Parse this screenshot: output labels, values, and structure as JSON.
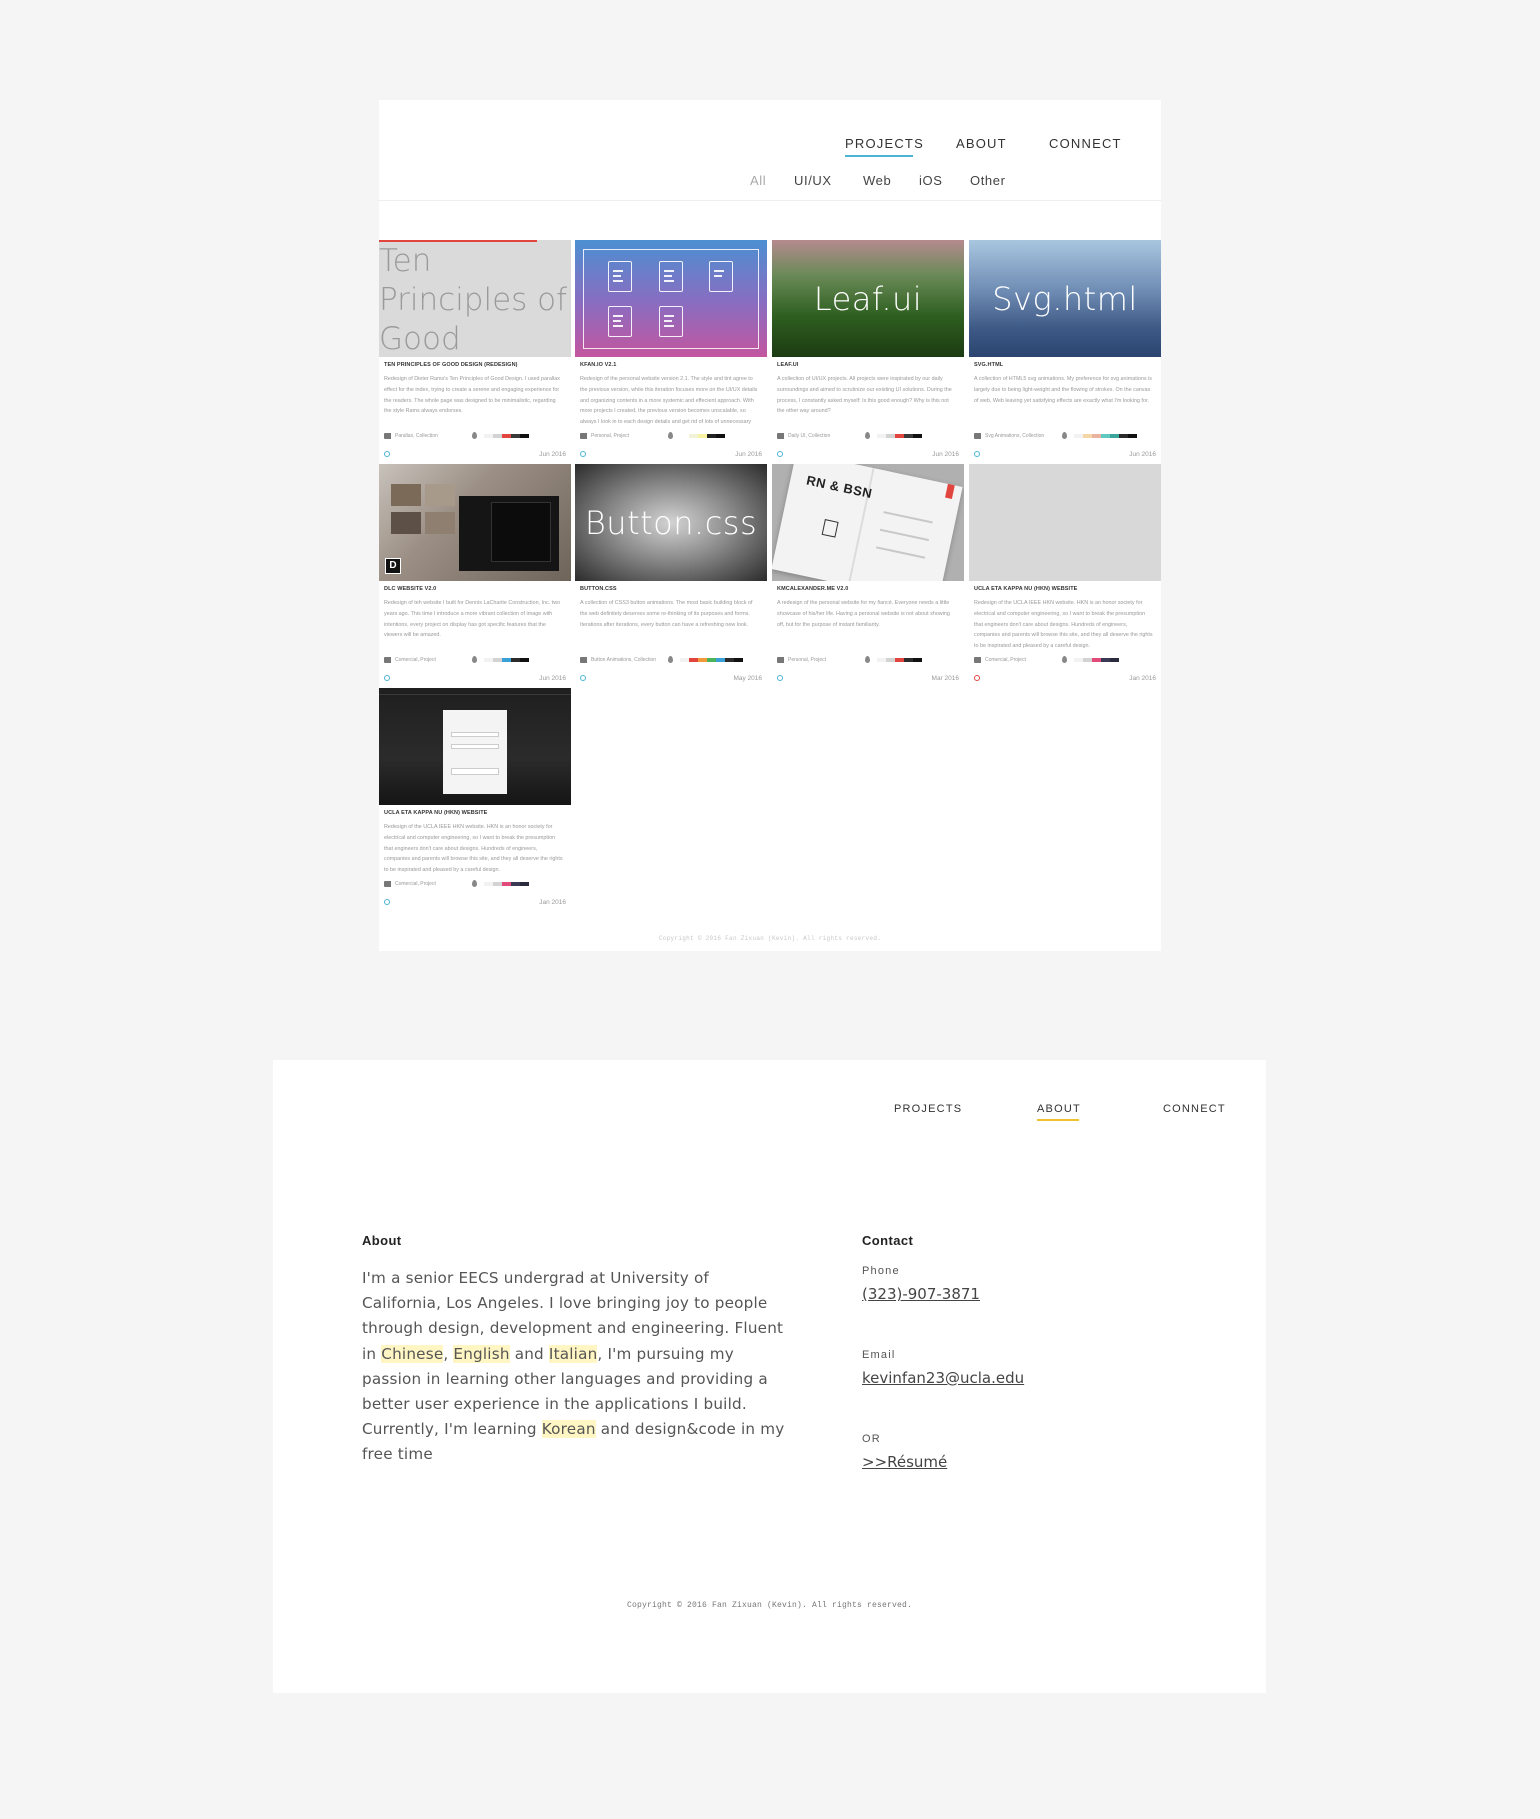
{
  "top": {
    "nav": {
      "projects": "PROJECTS",
      "about": "ABOUT",
      "connect": "CONNECT"
    },
    "filters": [
      "All",
      "UI/UX",
      "Web",
      "iOS",
      "Other"
    ],
    "projects": [
      {
        "thumb_title": "Ten Principles of Good Design",
        "name": "TEN PRINCIPLES OF GOOD DESIGN (REDESIGN)",
        "desc": "Redesign of Dieter Rams's Ten Principles of Good Design. I used parallax effect for the index, trying to create a serene and engaging experience for the readers. The whole page was designed to be minimalistic, regarding the style Rams always endorses.",
        "tags": "Parallax, Collection",
        "palette": [
          "#f2f2f2",
          "#d3d3d3",
          "#e2453e",
          "#3a3a3a",
          "#111111"
        ],
        "date": "Jun 2016",
        "status": "blue"
      },
      {
        "thumb_title": "",
        "name": "KFAN.IO V2.1",
        "desc": "Redesign of the personal website version 2.1. The style and tint agree to the previous version, while this iteration focuses more on the UI/UX details and organizing contents in a more systemic and effecient approach. With more projects I created, the previous version becomes unscalable, so always I look in to each design details and get rid of lots of unnecessary nuances.",
        "tags": "Personal, Project",
        "palette": [
          "#ffffff",
          "#f2f2d8",
          "#f7f3a0",
          "#222222",
          "#111111"
        ],
        "date": "Jun 2016",
        "status": "blue"
      },
      {
        "thumb_title": "Leaf.ui",
        "name": "LEAF.UI",
        "desc": "A collection of UI/UX projects. All projects were inspirated by our daily surroundings and aimed to scrutinize our existing UI solutions. During the process, I constantly asked myself: Is this good enough? Why is this not the other way around?",
        "tags": "Daily UI, Collection",
        "palette": [
          "#f2f2f2",
          "#d3d3d3",
          "#e2453e",
          "#3a3a3a",
          "#111111"
        ],
        "date": "Jun 2016",
        "status": "blue"
      },
      {
        "thumb_title": "Svg.html",
        "name": "SVG.HTML",
        "desc": "A collection of HTML5 svg animations. My preference for svg animations is largely due to being light-weight and the flowing of strokes. On the canvas of web, Web leaving yet satisfying effects are exactly what I'm looking for.",
        "tags": "Svg Animations, Collection",
        "palette": [
          "#f2f2f2",
          "#f4d7a7",
          "#e9b3a0",
          "#5ec9c0",
          "#3aa59b",
          "#2b2b2b",
          "#111111"
        ],
        "date": "Jun 2016",
        "status": "blue"
      },
      {
        "thumb_title": "",
        "name": "DLC WEBSITE V2.0",
        "desc": "Redesign of teh website I built for Dennis LaCharite Construction, Inc. two years ago. This time I introduce a more vibrant collection of image with intentions, every project on display has got specific features that the viewers will be amazed.",
        "tags": "Comercial, Project",
        "palette": [
          "#f2f2f2",
          "#d3d3d3",
          "#3aa1d8",
          "#2b2b2b",
          "#111111"
        ],
        "date": "Jun 2016",
        "status": "blue"
      },
      {
        "thumb_title": "Button.css",
        "name": "BUTTON.CSS",
        "desc": "A collection of CSS3 button animations. The most basic building block of the web definitely deserves some re-thinking of its purposes and forms. Iterations after iterations, every button can have a refreshing new look.",
        "tags": "Button Animations, Collection",
        "palette": [
          "#f2f2f2",
          "#e2453e",
          "#f29a3a",
          "#4bb35a",
          "#3aa1d8",
          "#2b2b2b",
          "#111111"
        ],
        "date": "May 2016",
        "status": "blue"
      },
      {
        "thumb_title": "",
        "name": "KMCALEXANDER.ME V2.0",
        "desc": "A redesign of the personal website for my fiancé. Everyone needs a little showcase of his/her life. Having a personal website is not about showing off, but for the purpose of instant familiarity.",
        "tags": "Personal, Project",
        "palette": [
          "#f2f2f2",
          "#d3d3d3",
          "#e2453e",
          "#2b2b2b",
          "#111111"
        ],
        "date": "Mar 2016",
        "status": "blue"
      },
      {
        "thumb_title": "",
        "name": "UCLA ETA KAPPA NU (HKN) WEBSITE",
        "desc": "Redesign of the UCLA IEEE HKN website. HKN is an honor society for electrical and computer engineering, so I want to break the presumption that engineers don't care about designs. Hundreds of engineers, companies and parents will browse this site, and they all deserve the rights to be inspirated and pleased by a careful design.",
        "tags": "Comercial, Project",
        "palette": [
          "#f2f2f2",
          "#d3d3d3",
          "#e24a7a",
          "#3a3a55",
          "#2b2b3e"
        ],
        "date": "Jan 2016",
        "status": "red"
      },
      {
        "thumb_title": "",
        "name": "UCLA ETA KAPPA NU (HKN) WEBSITE",
        "desc": "Redesign of the UCLA IEEE HKN website. HKN is an honor society for electrical and computer engineering, so I want to break the presumption that engineers don't care about designs. Hundreds of engineers, companies and parents will browse this site, and they all deserve the rights to be inspirated and pleased by a careful design.",
        "tags": "Comercial, Project",
        "palette": [
          "#f2f2f2",
          "#d3d3d3",
          "#e24a7a",
          "#3a3a55",
          "#2b2b3e"
        ],
        "date": "Jan 2016",
        "status": "blue"
      }
    ],
    "copyright": "Copyright © 2016 Fan Zixuan (Kevin). All rights reserved."
  },
  "bottom": {
    "nav": {
      "projects": "PROJECTS",
      "about": "ABOUT",
      "connect": "CONNECT"
    },
    "about": {
      "title": "About",
      "p1": "I'm a senior EECS undergrad at University of California, Los Angeles. I love bringing joy to people through design, development and engineering. Fluent in ",
      "lang1": "Chinese",
      "sep1": ", ",
      "lang2": "English",
      "p2": " and ",
      "lang3": "Italian",
      "p3": ", I'm pursuing my passion in learning other languages and providing a better user experience in the applications I build. Currently, I'm learning ",
      "lang4": "Korean",
      "p4": " and design&code in my free time"
    },
    "contact": {
      "title": "Contact",
      "phone_label": "Phone",
      "phone": "(323)-907-3871",
      "email_label": "Email",
      "email": "kevinfan23@ucla.edu",
      "or_label": "OR",
      "resume": ">>Résumé"
    },
    "copyright": "Copyright © 2016 Fan Zixuan (Kevin). All rights reserved."
  },
  "colors": {
    "accent_blue": "#4bb3d6",
    "accent_yellow": "#f2c12e",
    "accent_red": "#e2453e",
    "highlight": "#fff6c4",
    "page_bg": "#f5f5f5"
  }
}
